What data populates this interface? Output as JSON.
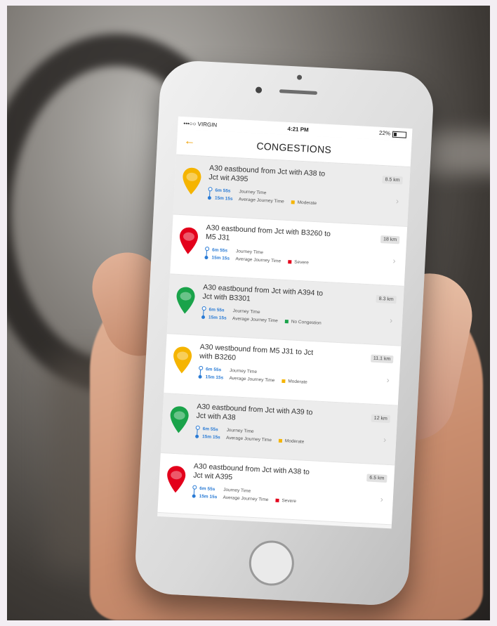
{
  "status_bar": {
    "carrier": "•••○○ VIRGIN",
    "time": "4:21 PM",
    "battery": "22%"
  },
  "header": {
    "back_icon": "arrow-left-icon",
    "title": "CONGESTIONS"
  },
  "labels": {
    "journey_time": "Journey Time",
    "avg_journey_time": "Average Journey Time"
  },
  "colors": {
    "Moderate": "#f5b400",
    "Severe": "#e3001b",
    "No Congestion": "#1aa34a",
    "accent": "#f0a000",
    "time_blue": "#2a7bd5"
  },
  "rows": [
    {
      "title": "A30 eastbound from Jct with A38 to Jct wit A395",
      "distance": "8.5 km",
      "journey_time": "6m 55s",
      "avg_time": "15m 15s",
      "status": "Moderate",
      "pin_color": "#f5b400"
    },
    {
      "title": "A30 eastbound from Jct with B3260 to M5 J31",
      "distance": "18 km",
      "journey_time": "6m 55s",
      "avg_time": "15m 15s",
      "status": "Severe",
      "pin_color": "#e3001b"
    },
    {
      "title": "A30 eastbound from Jct with A394 to Jct with B3301",
      "distance": "8.3 km",
      "journey_time": "6m 55s",
      "avg_time": "15m 15s",
      "status": "No Congestion",
      "pin_color": "#1aa34a"
    },
    {
      "title": "A30 westbound from M5 J31 to Jct with B3260",
      "distance": "11.1 km",
      "journey_time": "6m 55s",
      "avg_time": "15m 15s",
      "status": "Moderate",
      "pin_color": "#f5b400"
    },
    {
      "title": "A30 eastbound from Jct with A39 to Jct with A38",
      "distance": "12 km",
      "journey_time": "6m 55s",
      "avg_time": "15m 15s",
      "status": "Moderate",
      "pin_color": "#1aa34a"
    },
    {
      "title": "A30 eastbound from Jct with A38 to Jct wit A395",
      "distance": "6.5 km",
      "journey_time": "6m 55s",
      "avg_time": "15m 15s",
      "status": "Severe",
      "pin_color": "#e3001b"
    }
  ]
}
